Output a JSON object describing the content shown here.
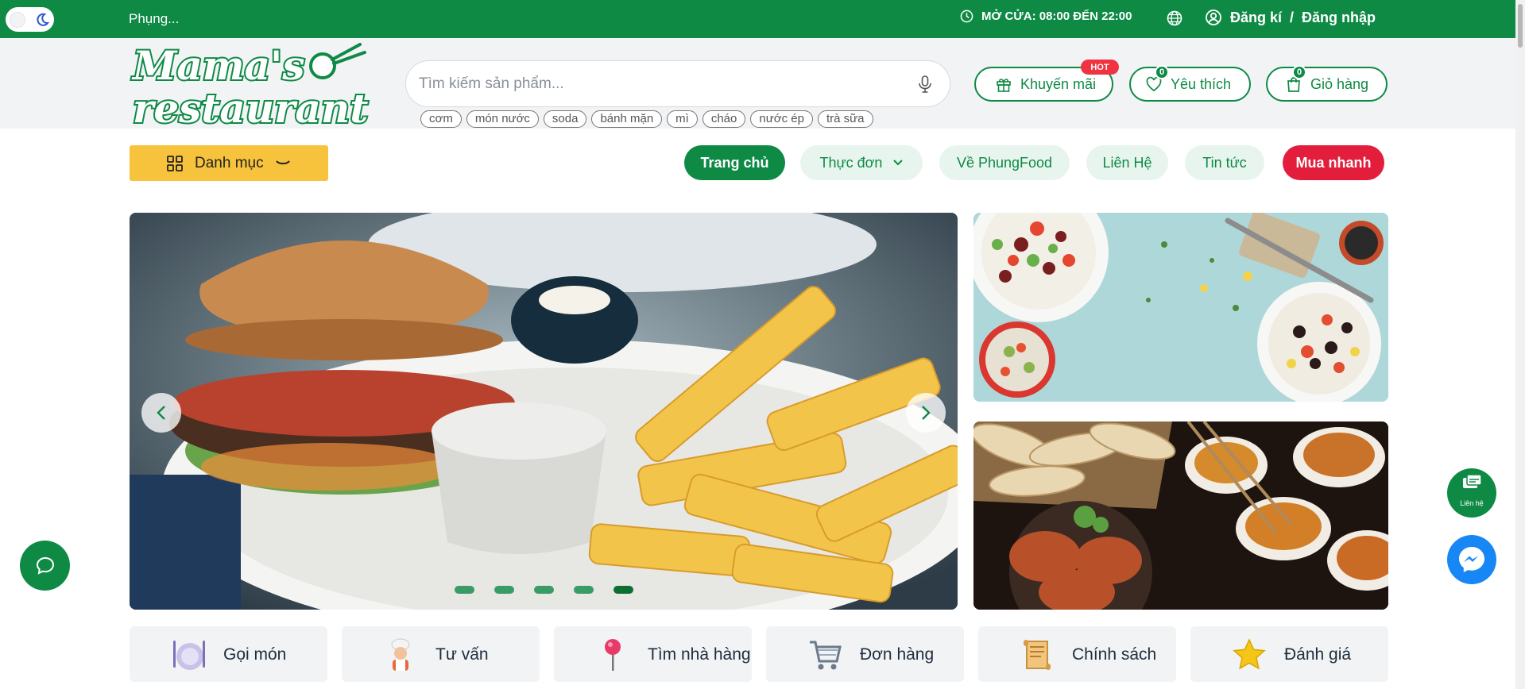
{
  "topbar": {
    "brand_text": "Phụng...",
    "hours": "MỞ CỬA: 08:00 ĐẾN 22:00",
    "register": "Đăng kí",
    "separator": "/",
    "login": "Đăng nhập",
    "bg_color": "#0e8a45"
  },
  "logo": {
    "line1": "Mama's",
    "line2": "restaurant"
  },
  "search": {
    "placeholder": "Tìm kiếm sản phẩm...",
    "tags": [
      "cơm",
      "món nước",
      "soda",
      "bánh mặn",
      "mì",
      "cháo",
      "nước ép",
      "trà sữa"
    ]
  },
  "header_buttons": {
    "promotions": "Khuyến mãi",
    "hot_badge": "HOT",
    "favorites": "Yêu thích",
    "favorites_count": "0",
    "cart": "Giỏ hàng",
    "cart_count": "0"
  },
  "category_button": "Danh mục",
  "nav": {
    "home": "Trang chủ",
    "menu": "Thực đơn",
    "about": "Về PhungFood",
    "contact": "Liên Hệ",
    "news": "Tin tức",
    "buy_now": "Mua nhanh"
  },
  "carousel": {
    "slide_count": 5,
    "active_slide": 5
  },
  "features": [
    {
      "label": "Gọi món",
      "icon": "plate-icon"
    },
    {
      "label": "Tư vấn",
      "icon": "chef-icon"
    },
    {
      "label": "Tìm nhà hàng",
      "icon": "pin-icon"
    },
    {
      "label": "Đơn hàng",
      "icon": "cart-icon"
    },
    {
      "label": "Chính sách",
      "icon": "scroll-icon"
    },
    {
      "label": "Đánh giá",
      "icon": "star-icon"
    }
  ],
  "floating": {
    "contact_label": "Liên hệ"
  },
  "colors": {
    "primary": "#0e8a45",
    "accent_yellow": "#f7c23c",
    "accent_red": "#e31e3c",
    "messenger": "#1787f5"
  }
}
